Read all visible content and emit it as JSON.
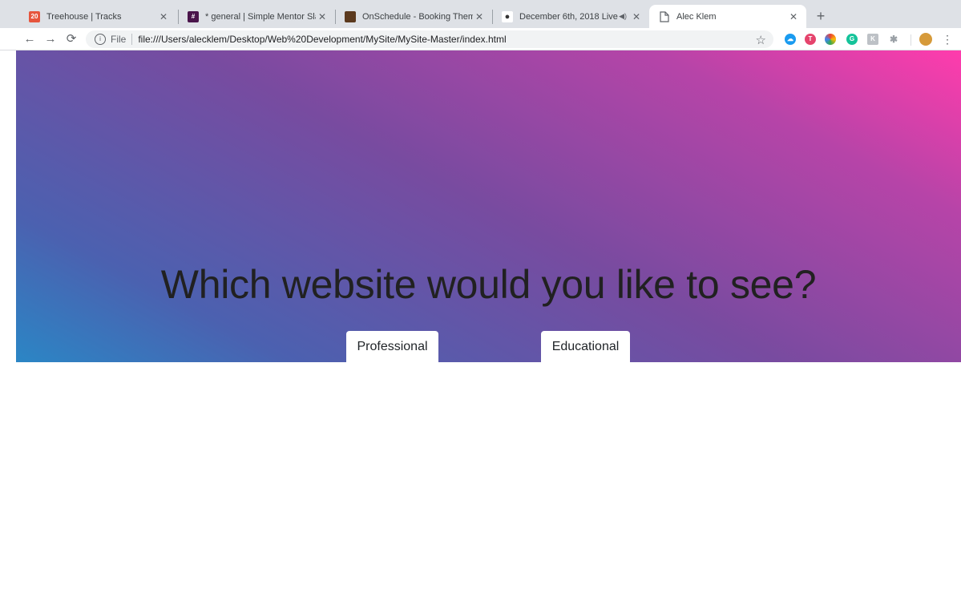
{
  "browser": {
    "tabs": [
      {
        "title": "Treehouse | Tracks",
        "favicon": "treehouse-icon",
        "active": false
      },
      {
        "title": "* general | Simple Mentor Slack",
        "favicon": "slack-icon",
        "active": false
      },
      {
        "title": "OnSchedule - Booking Theme",
        "favicon": "onschedule-icon",
        "active": false
      },
      {
        "title": "December 6th, 2018 Live",
        "favicon": "github-icon",
        "audio": true,
        "active": false
      },
      {
        "title": "Alec Klem",
        "favicon": "page-icon",
        "active": true
      }
    ],
    "address": {
      "scheme_label": "File",
      "url": "file:///Users/alecklem/Desktop/Web%20Development/MySite/MySite-Master/index.html"
    },
    "extensions": [
      {
        "name": "cloud-extension-icon",
        "color": "#1a9bf0"
      },
      {
        "name": "toggl-extension-icon",
        "color": "#e5446d"
      },
      {
        "name": "color-picker-extension-icon",
        "color": "#fbbc04"
      },
      {
        "name": "grammarly-extension-icon",
        "color": "#15c39a"
      },
      {
        "name": "k-extension-icon",
        "color": "#bdc1c6"
      },
      {
        "name": "bug-extension-icon",
        "color": "#9aa0a6"
      }
    ]
  },
  "page": {
    "title": "Which website would you like to see?",
    "buttons": {
      "professional": "Professional",
      "educational": "Educational"
    },
    "gradient": {
      "start": "#2b86c5",
      "middle": "#784ba0",
      "end": "#ff3cac"
    }
  }
}
